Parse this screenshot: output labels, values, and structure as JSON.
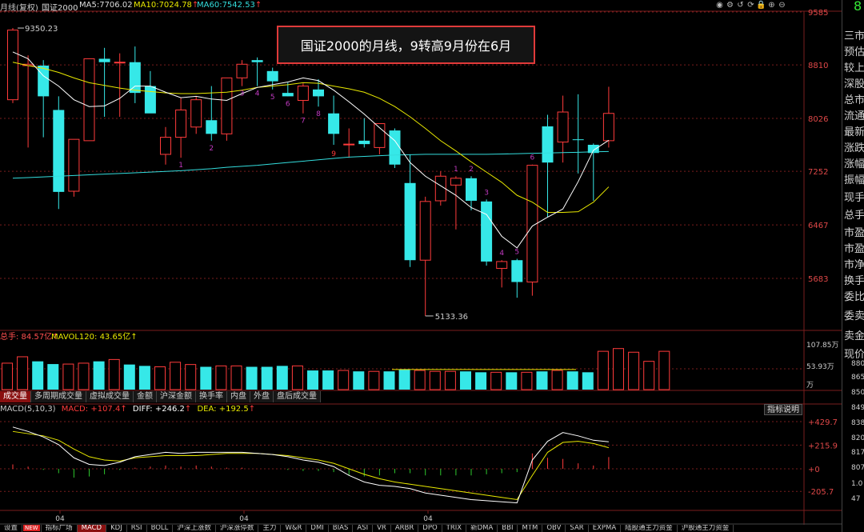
{
  "header": {
    "period": "月线(复权)",
    "name": "国证2000",
    "ma5_label": "MA5:",
    "ma5_value": "7706.02",
    "ma10_label": "MA10:",
    "ma10_value": "7024.78",
    "ma60_label": "MA60:",
    "ma60_value": "7542.53",
    "arrow": "↑",
    "ma5_color": "#ffffff",
    "ma10_color": "#e8e800",
    "ma60_color": "#33dddd"
  },
  "annotation": {
    "title": "国证2000的月线，9转高9月份在6月"
  },
  "toolbar_icons": [
    "eye-icon",
    "settings-icon",
    "undo-icon",
    "refresh-icon",
    "lock-icon",
    "zoom-in-icon",
    "zoom-out-icon"
  ],
  "toolbar_glyphs": [
    "◉",
    "⚙",
    "↺",
    "⟳",
    "🔒",
    "⊕",
    "⊖"
  ],
  "price_axis": [
    "9585",
    "8810",
    "8026",
    "7252",
    "6467",
    "5683"
  ],
  "extremes": {
    "high": "9350.23",
    "low": "5133.36"
  },
  "candles": [
    {
      "o": 8300,
      "h": 9350,
      "l": 8250,
      "c": 9320
    },
    {
      "o": 8800,
      "h": 8950,
      "l": 7600,
      "c": 8820
    },
    {
      "o": 8800,
      "h": 8880,
      "l": 7750,
      "c": 8350
    },
    {
      "o": 8150,
      "h": 8350,
      "l": 6700,
      "c": 6950
    },
    {
      "o": 6960,
      "h": 7700,
      "l": 6880,
      "c": 7720
    },
    {
      "o": 7700,
      "h": 8800,
      "l": 7720,
      "c": 8900
    },
    {
      "o": 8900,
      "h": 9060,
      "l": 8050,
      "c": 8850
    },
    {
      "o": 8850,
      "h": 8980,
      "l": 8050,
      "c": 8850
    },
    {
      "o": 8850,
      "h": 9080,
      "l": 8250,
      "c": 8400
    },
    {
      "o": 8500,
      "h": 8720,
      "l": 8150,
      "c": 8100
    },
    {
      "o": 7500,
      "h": 7900,
      "l": 7350,
      "c": 7750
    },
    {
      "o": 7750,
      "h": 8330,
      "l": 7450,
      "c": 8150
    },
    {
      "o": 7900,
      "h": 8350,
      "l": 7800,
      "c": 8300
    },
    {
      "o": 8000,
      "h": 8500,
      "l": 7700,
      "c": 7800
    },
    {
      "o": 7800,
      "h": 8620,
      "l": 7700,
      "c": 8620
    },
    {
      "o": 8620,
      "h": 8880,
      "l": 8500,
      "c": 8820
    },
    {
      "o": 8880,
      "h": 8920,
      "l": 8500,
      "c": 8850
    },
    {
      "o": 8720,
      "h": 8770,
      "l": 8450,
      "c": 8570
    },
    {
      "o": 8400,
      "h": 8550,
      "l": 8350,
      "c": 8350
    },
    {
      "o": 8290,
      "h": 8540,
      "l": 8100,
      "c": 8500
    },
    {
      "o": 8450,
      "h": 8600,
      "l": 8200,
      "c": 8350
    },
    {
      "o": 8100,
      "h": 8360,
      "l": 7640,
      "c": 7800
    },
    {
      "o": 7650,
      "h": 7880,
      "l": 7450,
      "c": 7650
    },
    {
      "o": 7700,
      "h": 8030,
      "l": 7600,
      "c": 7650
    },
    {
      "o": 7600,
      "h": 7900,
      "l": 7500,
      "c": 7950
    },
    {
      "o": 7850,
      "h": 7880,
      "l": 7300,
      "c": 7350
    },
    {
      "o": 7080,
      "h": 7500,
      "l": 5850,
      "c": 5950
    },
    {
      "o": 5950,
      "h": 6880,
      "l": 5133,
      "c": 6810
    },
    {
      "o": 6820,
      "h": 7250,
      "l": 6750,
      "c": 7180
    },
    {
      "o": 7050,
      "h": 7180,
      "l": 6400,
      "c": 7150
    },
    {
      "o": 7150,
      "h": 7180,
      "l": 6680,
      "c": 6820
    },
    {
      "o": 6810,
      "h": 6840,
      "l": 5870,
      "c": 5930
    },
    {
      "o": 5830,
      "h": 5950,
      "l": 5550,
      "c": 5930
    },
    {
      "o": 5950,
      "h": 5970,
      "l": 5400,
      "c": 5630
    },
    {
      "o": 5630,
      "h": 7350,
      "l": 5430,
      "c": 7340
    },
    {
      "o": 7910,
      "h": 8080,
      "l": 6580,
      "c": 7380
    },
    {
      "o": 7680,
      "h": 8360,
      "l": 7380,
      "c": 8120
    },
    {
      "o": 7720,
      "h": 8380,
      "l": 7220,
      "c": 7710
    },
    {
      "o": 7640,
      "h": 7660,
      "l": 6820,
      "c": 7520
    },
    {
      "o": 7700,
      "h": 8490,
      "l": 7600,
      "c": 8100
    }
  ],
  "ma5": [
    9000,
    8900,
    8650,
    8500,
    8300,
    8200,
    8210,
    8320,
    8500,
    8500,
    8410,
    8330,
    8350,
    8310,
    8290,
    8390,
    8480,
    8520,
    8560,
    8620,
    8580,
    8440,
    8270,
    8090,
    7890,
    7700,
    7380,
    7180,
    7040,
    6900,
    6720,
    6620,
    6300,
    6130,
    6450,
    6580,
    6700,
    7100,
    7560,
    7706
  ],
  "ma10": [
    8850,
    8800,
    8760,
    8700,
    8620,
    8550,
    8510,
    8470,
    8440,
    8420,
    8400,
    8390,
    8390,
    8400,
    8410,
    8440,
    8480,
    8500,
    8520,
    8550,
    8540,
    8500,
    8460,
    8410,
    8320,
    8200,
    8050,
    7880,
    7700,
    7550,
    7390,
    7240,
    7090,
    6900,
    6800,
    6650,
    6650,
    6660,
    6800,
    7024
  ],
  "ma60": [
    7150,
    7160,
    7170,
    7180,
    7190,
    7200,
    7210,
    7220,
    7230,
    7240,
    7250,
    7260,
    7275,
    7290,
    7310,
    7325,
    7340,
    7360,
    7380,
    7400,
    7420,
    7440,
    7460,
    7470,
    7480,
    7490,
    7495,
    7500,
    7500,
    7500,
    7500,
    7500,
    7505,
    7510,
    7515,
    7520,
    7525,
    7530,
    7538,
    7542
  ],
  "td_marks": [
    {
      "i": 11,
      "t": "1",
      "pos": "below"
    },
    {
      "i": 13,
      "t": "2",
      "pos": "below"
    },
    {
      "i": 15,
      "t": "3",
      "pos": "below"
    },
    {
      "i": 16,
      "t": "4",
      "pos": "below"
    },
    {
      "i": 17,
      "t": "5",
      "pos": "below"
    },
    {
      "i": 18,
      "t": "6",
      "pos": "below"
    },
    {
      "i": 19,
      "t": "7",
      "pos": "below"
    },
    {
      "i": 20,
      "t": "8",
      "pos": "below"
    },
    {
      "i": 21,
      "t": "9",
      "pos": "below_red"
    },
    {
      "i": 29,
      "t": "1",
      "pos": "above"
    },
    {
      "i": 30,
      "t": "2",
      "pos": "above"
    },
    {
      "i": 31,
      "t": "3",
      "pos": "above"
    },
    {
      "i": 32,
      "t": "4",
      "pos": "above"
    },
    {
      "i": 33,
      "t": "5",
      "pos": "above"
    },
    {
      "i": 34,
      "t": "6",
      "pos": "above"
    }
  ],
  "volume": {
    "label": "总手:",
    "value": "84.57亿",
    "arrow": "↑",
    "mavol_label": "MAVOL120:",
    "mavol_value": "43.65亿",
    "axis": [
      "107.85万",
      "53.93万",
      "万"
    ],
    "bars": [
      58,
      72,
      62,
      56,
      56,
      58,
      62,
      66,
      55,
      52,
      50,
      60,
      55,
      50,
      52,
      52,
      50,
      50,
      52,
      52,
      42,
      42,
      42,
      40,
      40,
      40,
      44,
      42,
      40,
      40,
      40,
      38,
      38,
      38,
      38,
      40,
      42,
      40,
      38,
      84,
      90,
      82,
      62,
      84
    ],
    "mavol": 44
  },
  "vol_tabs": [
    "成交量",
    "多周期成交量",
    "虚拟成交量",
    "金额",
    "沪深金额",
    "换手率",
    "内盘",
    "外盘",
    "盘后成交量"
  ],
  "macd": {
    "label": "MACD(5,10,3)",
    "macd_label": "MACD:",
    "macd_value": "+107.4",
    "diff_label": "DIFF:",
    "diff_value": "+246.2",
    "dea_label": "DEA:",
    "dea_value": "+192.5",
    "arrow": "↑",
    "button": "指标说明",
    "axis": [
      "+429.7",
      "+215.9",
      "+0",
      "-205.7"
    ],
    "diff": [
      380,
      340,
      290,
      220,
      100,
      40,
      30,
      60,
      110,
      130,
      150,
      140,
      150,
      150,
      150,
      150,
      140,
      130,
      110,
      80,
      60,
      20,
      -60,
      -120,
      -150,
      -160,
      -180,
      -220,
      -240,
      -260,
      -280,
      -290,
      -300,
      -310,
      80,
      250,
      330,
      300,
      260,
      246
    ],
    "dea": [
      340,
      320,
      300,
      260,
      180,
      110,
      80,
      70,
      100,
      110,
      120,
      120,
      120,
      130,
      140,
      140,
      140,
      130,
      120,
      100,
      80,
      50,
      0,
      -50,
      -90,
      -120,
      -140,
      -160,
      -180,
      -200,
      -220,
      -240,
      -260,
      -280,
      -60,
      150,
      240,
      250,
      230,
      192
    ],
    "hist": [
      40,
      20,
      -10,
      -40,
      -80,
      -70,
      -50,
      -10,
      10,
      20,
      30,
      20,
      30,
      20,
      10,
      10,
      0,
      0,
      -10,
      -20,
      -20,
      -30,
      -60,
      -70,
      -60,
      -40,
      -40,
      -60,
      -60,
      -60,
      -60,
      -50,
      -40,
      -30,
      140,
      100,
      90,
      50,
      30,
      107
    ]
  },
  "date_labels": [
    "04",
    "04",
    "04"
  ],
  "bottom_tabs": [
    "设置",
    "NEW",
    "指标广场",
    "MACD",
    "KDJ",
    "RSI",
    "BOLL",
    "沪深上涨数",
    "沪深涨停数",
    "主力",
    "W&R",
    "DMI",
    "BIAS",
    "ASI",
    "VR",
    "ARBR",
    "DPO",
    "TRIX",
    "新DMA",
    "BBI",
    "MTM",
    "OBV",
    "SAR",
    "EXPMA",
    "陆股通主力资金",
    "沪股通主力资金"
  ],
  "right_panel": {
    "top_value": "8",
    "labels": [
      "三市",
      "预估",
      "较上",
      "深股",
      "总市",
      "流通",
      "最新",
      "涨跌",
      "涨幅",
      "振幅",
      "现手",
      "总手",
      "市盈",
      "市盈",
      "市净",
      "换手",
      "委比",
      "委卖",
      "卖金",
      "现价"
    ],
    "numbers": [
      "880",
      "865",
      "850",
      "849",
      "838",
      "820",
      "817",
      "807",
      "1.0",
      "47"
    ]
  },
  "colors": {
    "up": "#ff3b3b",
    "down": "#36e8e8",
    "grid": "#7a1e1e",
    "bg": "#000000"
  }
}
